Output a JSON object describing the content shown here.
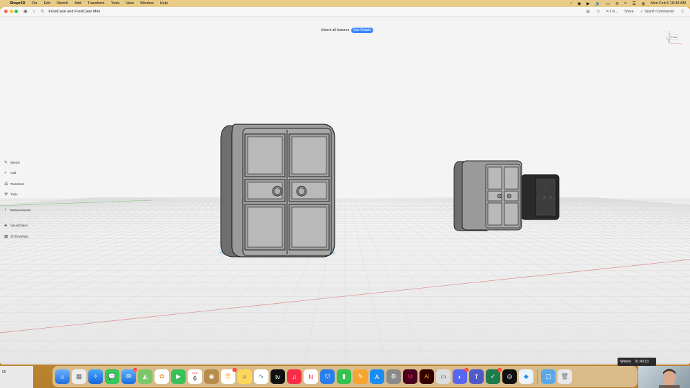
{
  "menubar": {
    "app_name": "Shapr3D",
    "menus": [
      "File",
      "Edit",
      "Sketch",
      "Add",
      "Transform",
      "Tools",
      "View",
      "Window",
      "Help"
    ],
    "datetime": "Mon Feb 6  10:28 AM"
  },
  "window": {
    "doc_title": "FrostCase and FrostCase Mini",
    "units": "1 in",
    "share_label": "Share",
    "search_label": "Search Commands"
  },
  "banner": {
    "text": "Unlock all features",
    "button": "See Details"
  },
  "viewcube": {
    "face": "Front"
  },
  "left_tools": [
    {
      "label": "Sketch",
      "icon": "pencil-icon"
    },
    {
      "label": "Add",
      "icon": "plus-icon"
    },
    {
      "label": "Transform",
      "icon": "transform-icon"
    },
    {
      "label": "Tools",
      "icon": "wrench-icon"
    },
    {
      "label": "Measurements",
      "icon": "ruler-icon"
    },
    {
      "label": "Visualization",
      "icon": "visualization-icon"
    },
    {
      "label": "2D Drawings",
      "icon": "drawings-icon"
    }
  ],
  "webex": {
    "name": "Webex",
    "time": "01:40:13"
  },
  "dock": {
    "mail_badge": "14",
    "reminders_badge": "1",
    "discord_badge": "1",
    "teams_badge": "3",
    "calendar_month": "FEB",
    "calendar_day": "6"
  },
  "thumb_text": "56",
  "colors": {
    "accent": "#3a86ff",
    "viewport_bg": "#f4f4f4"
  }
}
